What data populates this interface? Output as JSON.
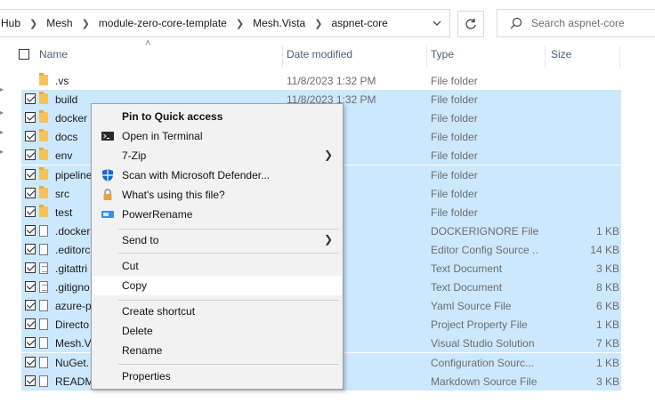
{
  "address": {
    "crumbs": [
      "Hub",
      "Mesh",
      "module-zero-core-template",
      "Mesh.Vista",
      "aspnet-core"
    ],
    "search_placeholder": "Search aspnet-core"
  },
  "columns": {
    "name": "Name",
    "date": "Date modified",
    "type": "Type",
    "size": "Size"
  },
  "rows": [
    {
      "name": ".vs",
      "date": "11/8/2023 1:32 PM",
      "type": "File folder",
      "size": "",
      "icon": "folder-icon",
      "selected": false
    },
    {
      "name": "build",
      "date": "11/8/2023 1:32 PM",
      "type": "File folder",
      "size": "",
      "icon": "folder-icon",
      "selected": true
    },
    {
      "name": "docker",
      "date": "32 PM",
      "type": "File folder",
      "size": "",
      "icon": "folder-icon",
      "selected": true
    },
    {
      "name": "docs",
      "date": "32 PM",
      "type": "File folder",
      "size": "",
      "icon": "folder-icon",
      "selected": true
    },
    {
      "name": "env",
      "date": "32 PM",
      "type": "File folder",
      "size": "",
      "icon": "folder-icon",
      "selected": true
    },
    {
      "name": "pipeline",
      "date": "32 PM",
      "type": "File folder",
      "size": "",
      "icon": "folder-icon",
      "selected": true
    },
    {
      "name": "src",
      "date": "32 PM",
      "type": "File folder",
      "size": "",
      "icon": "folder-icon",
      "selected": true
    },
    {
      "name": "test",
      "date": "32 PM",
      "type": "File folder",
      "size": "",
      "icon": "folder-icon",
      "selected": true
    },
    {
      "name": ".docker",
      "date": "51 PM",
      "type": "DOCKERIGNORE File",
      "size": "1 KB",
      "icon": "file-icon",
      "selected": true
    },
    {
      "name": ".editorc",
      "date": "02 PM",
      "type": "Editor Config Source ...",
      "size": "14 KB",
      "icon": "file-icon",
      "selected": true
    },
    {
      "name": ".gitattri",
      "date": "51 PM",
      "type": "Text Document",
      "size": "3 KB",
      "icon": "text-file-icon",
      "selected": true
    },
    {
      "name": ".gitigno",
      "date": "33 AM",
      "type": "Text Document",
      "size": "8 KB",
      "icon": "text-file-icon",
      "selected": true
    },
    {
      "name": "azure-p",
      "date": "33 AM",
      "type": "Yaml Source File",
      "size": "6 KB",
      "icon": "file-icon",
      "selected": true
    },
    {
      "name": "Directo",
      "date": "14 PM",
      "type": "Project Property File",
      "size": "1 KB",
      "icon": "project-file-icon",
      "selected": true
    },
    {
      "name": "Mesh.V",
      "date": "32 PM",
      "type": "Visual Studio Solution",
      "size": "7 KB",
      "icon": "solution-file-icon",
      "selected": true
    },
    {
      "name": "NuGet.",
      "date": "02 PM",
      "type": "Configuration Sourc...",
      "size": "1 KB",
      "icon": "config-file-icon",
      "selected": true
    },
    {
      "name": "READM",
      "date": "32 PM",
      "type": "Markdown Source File",
      "size": "3 KB",
      "icon": "markdown-file-icon",
      "selected": true
    }
  ],
  "menu": {
    "pin": "Pin to Quick access",
    "terminal": "Open in Terminal",
    "zip": "7-Zip",
    "defender": "Scan with Microsoft Defender...",
    "using": "What's using this file?",
    "rename_power": "PowerRename",
    "send_to": "Send to",
    "cut": "Cut",
    "copy": "Copy",
    "shortcut": "Create shortcut",
    "delete": "Delete",
    "rename": "Rename",
    "properties": "Properties"
  }
}
